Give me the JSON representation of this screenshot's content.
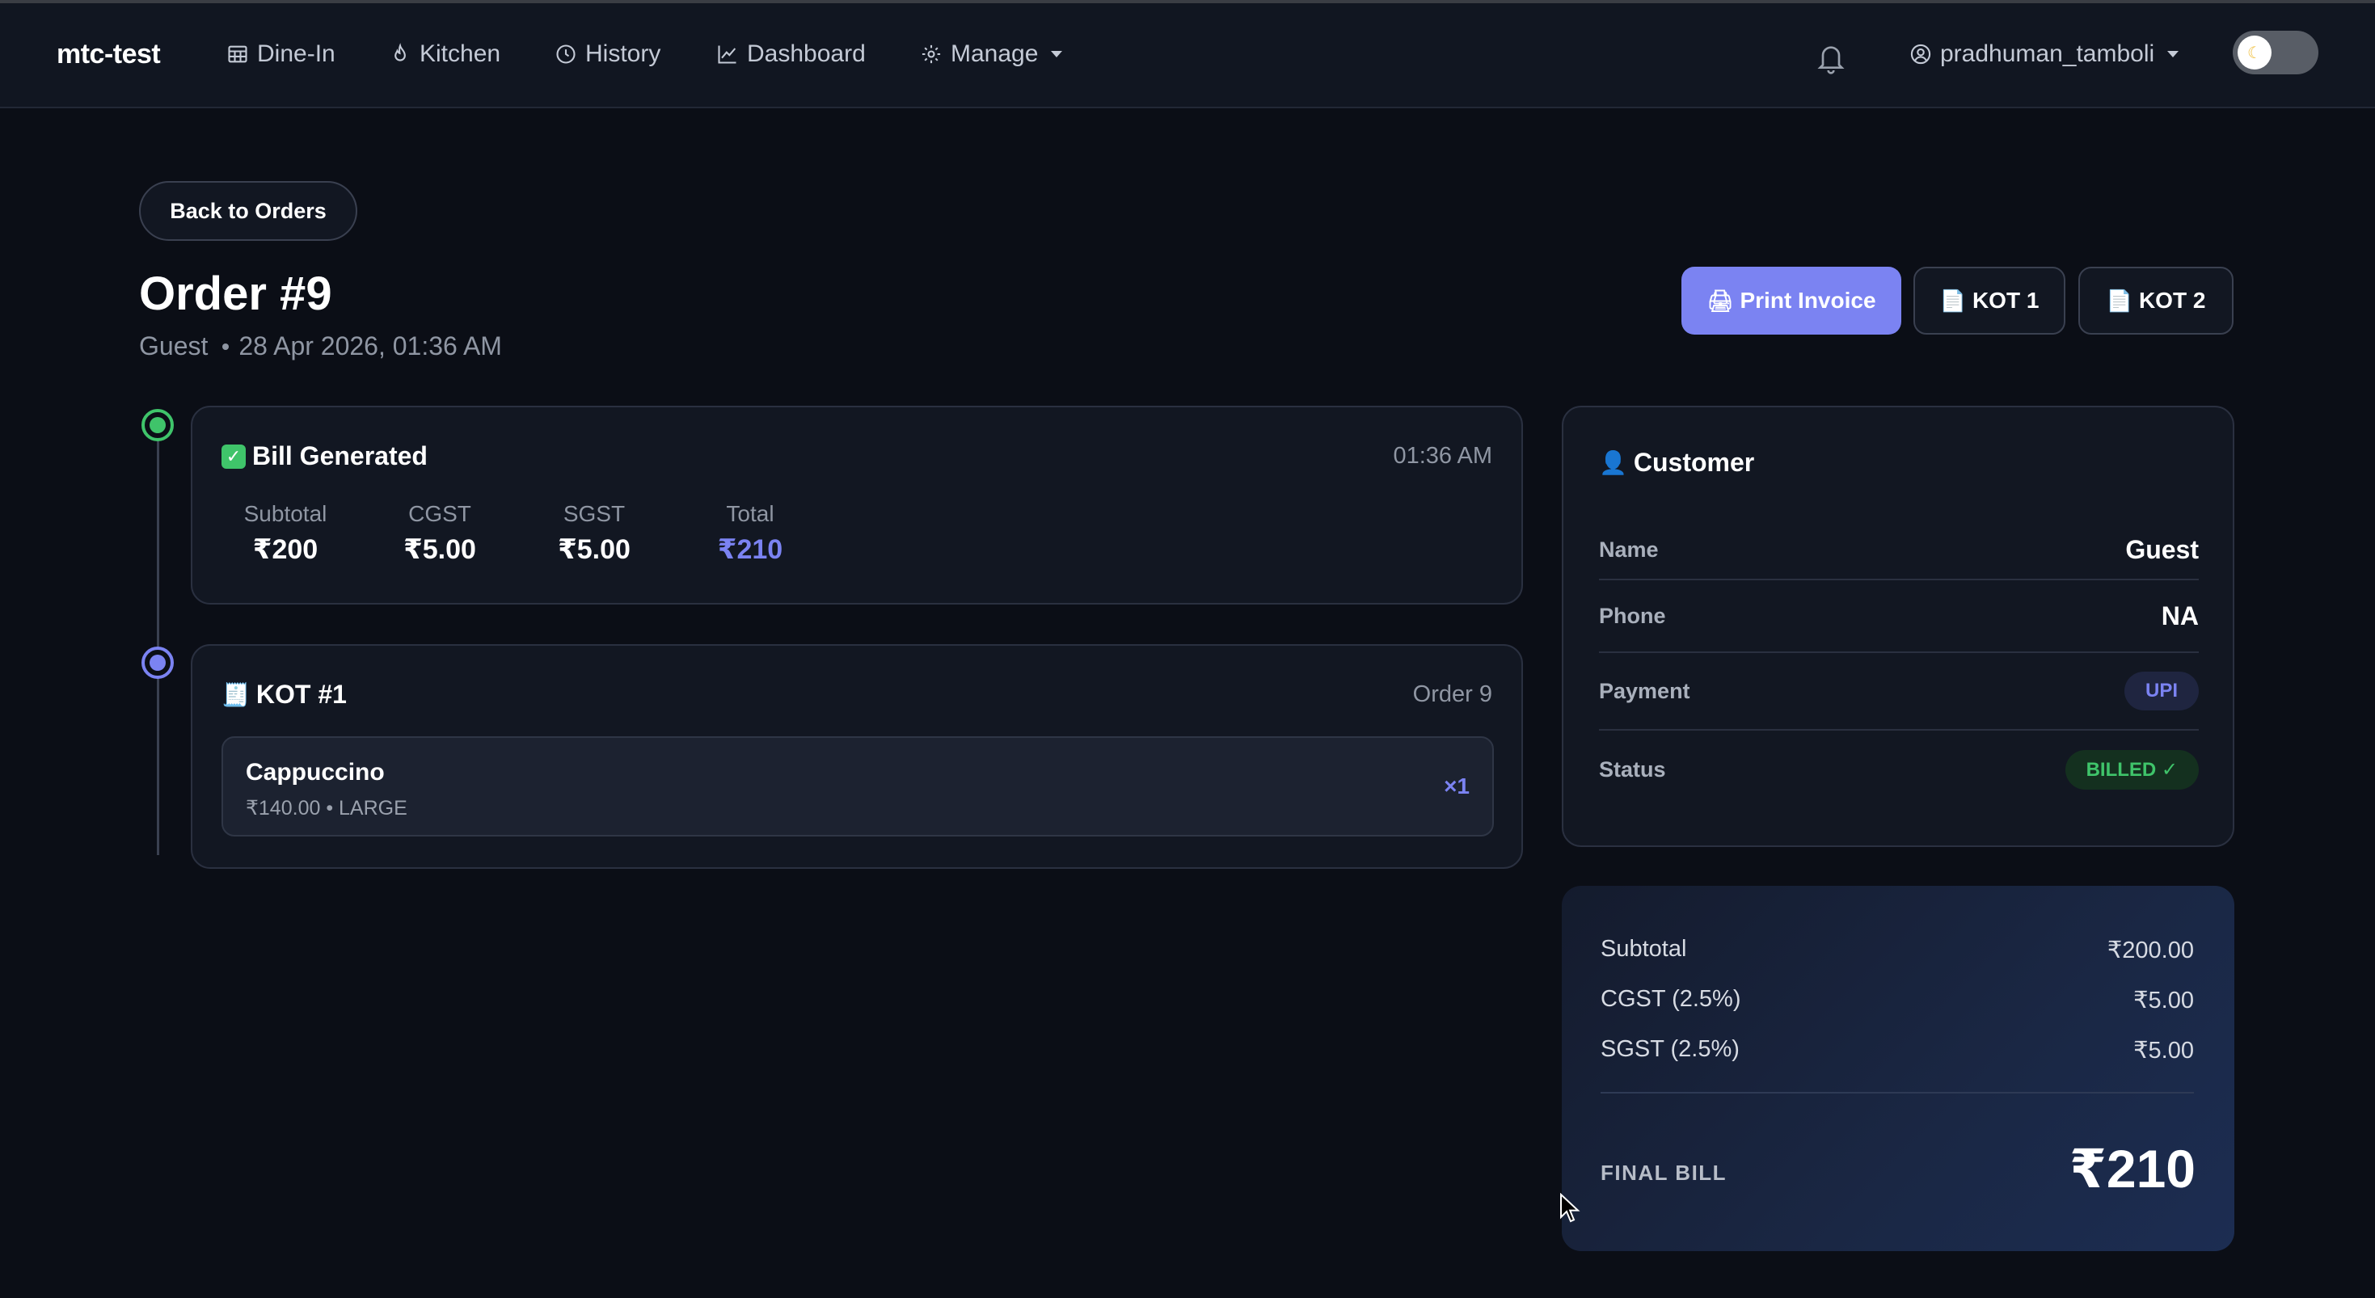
{
  "nav": {
    "brand": "mtc-test",
    "items": [
      {
        "label": "Dine-In",
        "icon": "table-icon"
      },
      {
        "label": "Kitchen",
        "icon": "flame-icon"
      },
      {
        "label": "History",
        "icon": "clock-icon"
      },
      {
        "label": "Dashboard",
        "icon": "chart-line-icon"
      },
      {
        "label": "Manage",
        "icon": "gear-icon"
      }
    ],
    "user": "pradhuman_tamboli"
  },
  "page": {
    "back_label": "Back to Orders",
    "title": "Order #9",
    "customer": "Guest",
    "datetime": "28 Apr 2026, 01:36 AM",
    "actions": {
      "print": "Print Invoice",
      "kot1": "KOT 1",
      "kot2": "KOT 2"
    }
  },
  "bill": {
    "title": "Bill Generated",
    "time": "01:36 AM",
    "stats": [
      {
        "label": "Subtotal",
        "value": "₹200"
      },
      {
        "label": "CGST",
        "value": "₹5.00"
      },
      {
        "label": "SGST",
        "value": "₹5.00"
      },
      {
        "label": "Total",
        "value": "₹210"
      }
    ]
  },
  "kot": {
    "title": "KOT #1",
    "order_ref": "Order 9",
    "items": [
      {
        "name": "Cappuccino",
        "meta": "₹140.00 • LARGE",
        "qty": "×1"
      }
    ]
  },
  "customer": {
    "title": "Customer",
    "rows": [
      {
        "label": "Name",
        "value": "Guest"
      },
      {
        "label": "Phone",
        "value": "NA"
      },
      {
        "label": "Payment",
        "value": "UPI"
      },
      {
        "label": "Status",
        "value": "BILLED ✓"
      }
    ]
  },
  "summary": {
    "rows": [
      {
        "label": "Subtotal",
        "value": "₹200.00"
      },
      {
        "label": "CGST (2.5%)",
        "value": "₹5.00"
      },
      {
        "label": "SGST (2.5%)",
        "value": "₹5.00"
      }
    ],
    "final_label": "FINAL BILL",
    "final_value": "₹210"
  },
  "colors": {
    "accent": "#7b83f2",
    "success": "#3fc46a",
    "background": "#0b0e16"
  }
}
